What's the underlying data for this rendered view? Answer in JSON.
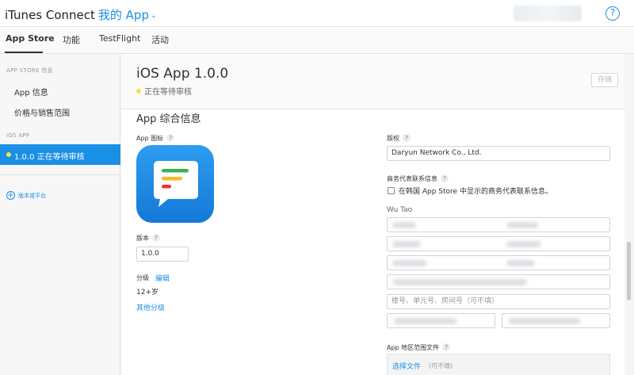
{
  "topbar": {
    "brand": "iTunes Connect",
    "my_app": "我的 App",
    "help_label": "?",
    "chevron": "⌄"
  },
  "tabs": [
    {
      "label": "App Store",
      "active": true
    },
    {
      "label": "功能",
      "active": false
    },
    {
      "label": "TestFlight",
      "active": false
    },
    {
      "label": "活动",
      "active": false
    }
  ],
  "sidebar": {
    "section_store": "APP STORE 信息",
    "item_app_info": "App 信息",
    "item_pricing": "价格与销售范围",
    "section_ios": "iOS APP",
    "active_item": "1.0.0 正在等待审核",
    "add_platform": "版本或平台"
  },
  "header": {
    "title": "iOS App 1.0.0",
    "status": "正在等待审核",
    "save": "存储"
  },
  "general": {
    "section_title": "App 综合信息",
    "icon_label": "App 图标",
    "version_label": "版本",
    "version_value": "1.0.0",
    "rating_label": "分级",
    "rating_edit": "编辑",
    "rating_value": "12+岁",
    "other_ratings": "其他分级"
  },
  "right": {
    "copyright_label": "版权",
    "copyright_value": "Daryun Network Co., Ltd.",
    "rep_label": "商务代表联系信息",
    "korea_checkbox": "在韩国 App Store 中显示的商务代表联系信息。",
    "contact_name": "Wu Tao",
    "address_placeholder": "楼号、单元号、房间号（可不填）",
    "region_file_label": "App 地区范围文件",
    "choose_file": "选择文件",
    "optional": "(可不填)"
  },
  "help_mark": "?",
  "colors": {
    "accent": "#1a8fe6",
    "status_pending": "#f5e23c",
    "icon_bg": "#1a85e0"
  }
}
